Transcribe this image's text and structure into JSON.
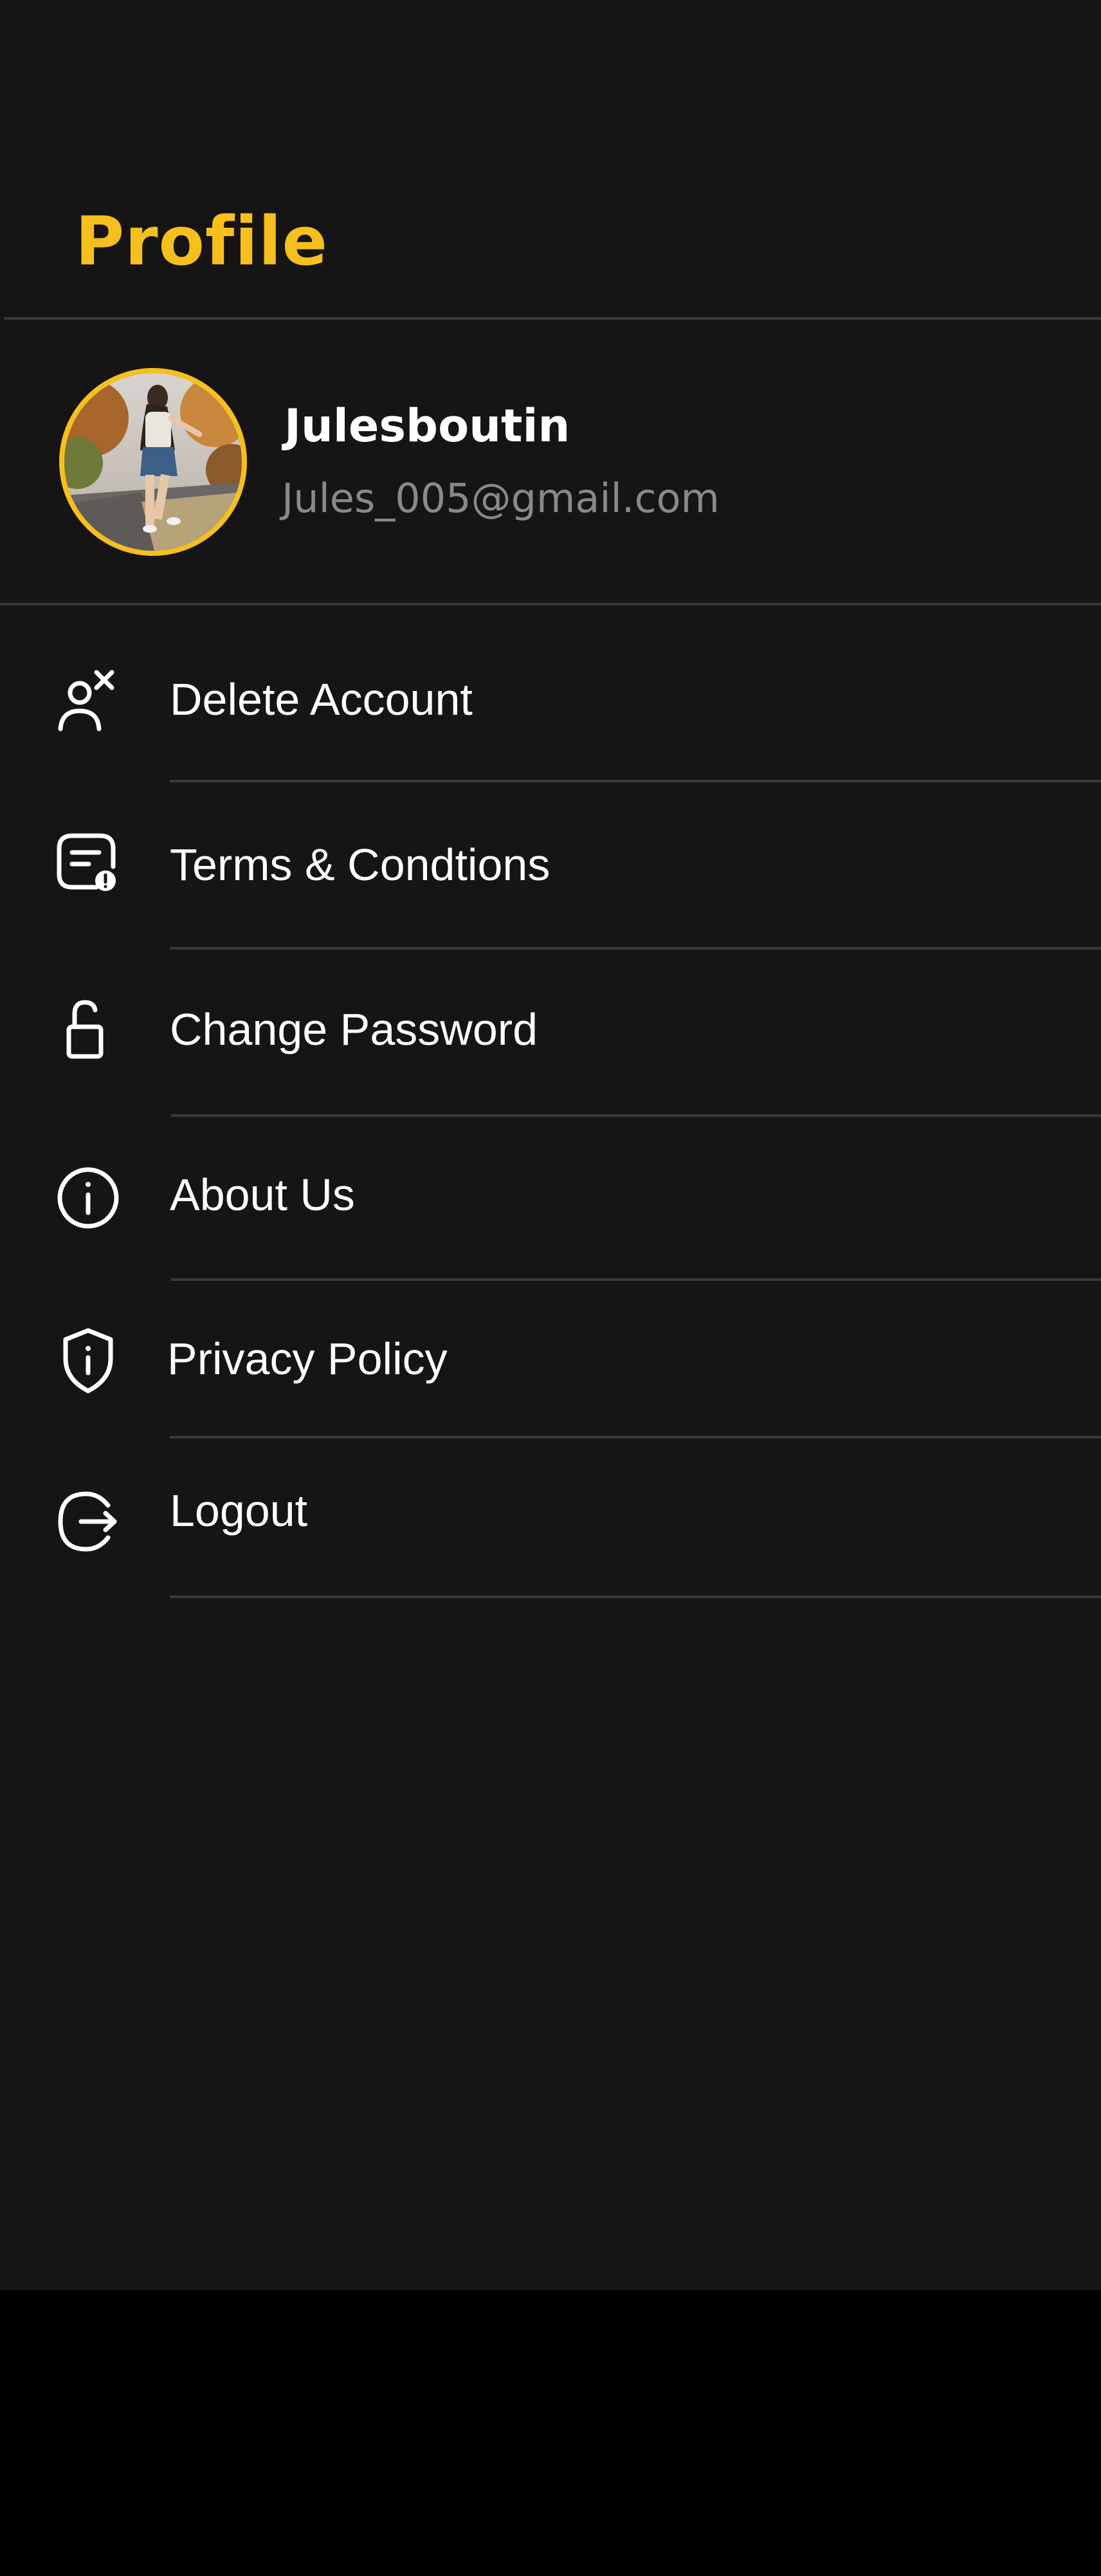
{
  "header": {
    "title": "Profile"
  },
  "profile": {
    "name": "Julesboutin",
    "email": "Jules_005@gmail.com",
    "avatar_icon": "user-photo"
  },
  "menu": {
    "items": [
      {
        "id": "delete-account",
        "label": "Delete Account",
        "icon": "user-remove-icon"
      },
      {
        "id": "terms",
        "label": "Terms & Condtions",
        "icon": "document-alert-icon"
      },
      {
        "id": "change-password",
        "label": "Change Password",
        "icon": "unlock-icon"
      },
      {
        "id": "about-us",
        "label": "About Us",
        "icon": "info-circle-icon"
      },
      {
        "id": "privacy-policy",
        "label": "Privacy Policy",
        "icon": "shield-info-icon"
      },
      {
        "id": "logout",
        "label": "Logout",
        "icon": "logout-icon"
      }
    ]
  },
  "colors": {
    "background": "#161415",
    "accent": "#F5C01D",
    "text_primary": "#FFFFFF",
    "text_secondary": "#8a8889",
    "divider": "#3a3839",
    "bottom_bar": "#000000"
  }
}
